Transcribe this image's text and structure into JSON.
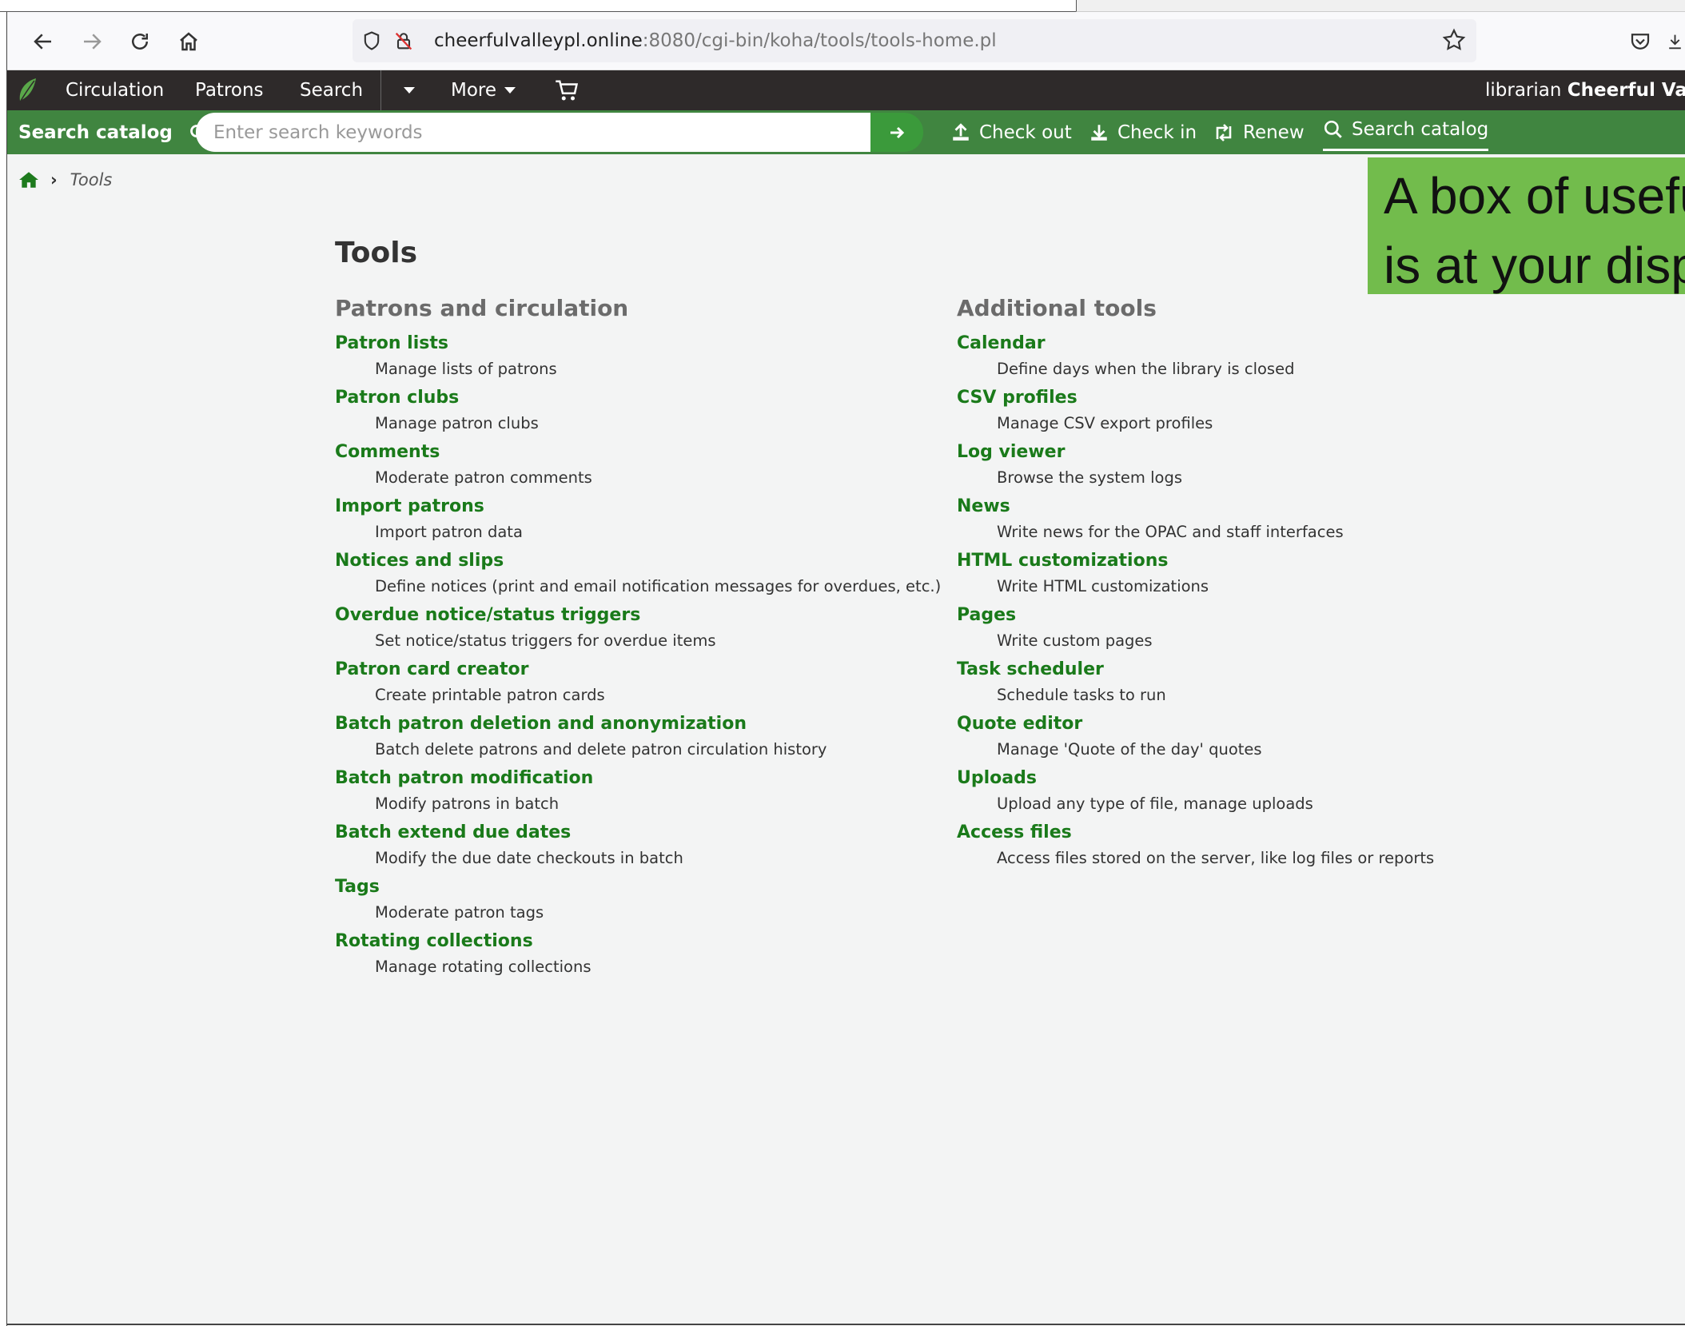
{
  "browser": {
    "url_host": "cheerfulvalleypl.online",
    "url_rest": ":8080/cgi-bin/koha/tools/tools-home.pl"
  },
  "topnav": {
    "items": [
      "Circulation",
      "Patrons",
      "Search",
      "More"
    ],
    "user_prefix": "librarian",
    "library_name": "Cheerful Valley"
  },
  "searchbar": {
    "label": "Search catalog",
    "placeholder": "Enter search keywords",
    "quick_links": [
      "Check out",
      "Check in",
      "Renew",
      "Search catalog"
    ]
  },
  "breadcrumb": {
    "current": "Tools"
  },
  "callout": {
    "line1": "A box of useful",
    "line2": "is at your disposal"
  },
  "page": {
    "title": "Tools",
    "left_heading": "Patrons and circulation",
    "right_heading": "Additional tools",
    "left_tools": [
      {
        "name": "Patron lists",
        "desc": "Manage lists of patrons"
      },
      {
        "name": "Patron clubs",
        "desc": "Manage patron clubs"
      },
      {
        "name": "Comments",
        "desc": "Moderate patron comments"
      },
      {
        "name": "Import patrons",
        "desc": "Import patron data"
      },
      {
        "name": "Notices and slips",
        "desc": "Define notices (print and email notification messages for overdues, etc.)"
      },
      {
        "name": "Overdue notice/status triggers",
        "desc": "Set notice/status triggers for overdue items"
      },
      {
        "name": "Patron card creator",
        "desc": "Create printable patron cards"
      },
      {
        "name": "Batch patron deletion and anonymization",
        "desc": "Batch delete patrons and delete patron circulation history"
      },
      {
        "name": "Batch patron modification",
        "desc": "Modify patrons in batch"
      },
      {
        "name": "Batch extend due dates",
        "desc": "Modify the due date checkouts in batch"
      },
      {
        "name": "Tags",
        "desc": "Moderate patron tags"
      },
      {
        "name": "Rotating collections",
        "desc": "Manage rotating collections"
      }
    ],
    "right_tools": [
      {
        "name": "Calendar",
        "desc": "Define days when the library is closed"
      },
      {
        "name": "CSV profiles",
        "desc": "Manage CSV export profiles"
      },
      {
        "name": "Log viewer",
        "desc": "Browse the system logs"
      },
      {
        "name": "News",
        "desc": "Write news for the OPAC and staff interfaces"
      },
      {
        "name": "HTML customizations",
        "desc": "Write HTML customizations"
      },
      {
        "name": "Pages",
        "desc": "Write custom pages"
      },
      {
        "name": "Task scheduler",
        "desc": "Schedule tasks to run"
      },
      {
        "name": "Quote editor",
        "desc": "Manage 'Quote of the day' quotes"
      },
      {
        "name": "Uploads",
        "desc": "Upload any type of file, manage uploads"
      },
      {
        "name": "Access files",
        "desc": "Access files stored on the server, like log files or reports"
      }
    ]
  }
}
